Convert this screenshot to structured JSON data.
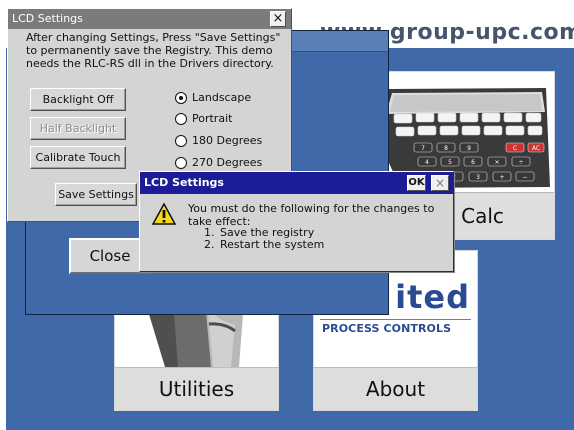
{
  "background": {
    "url_text": "www.group-upc.com",
    "colors": {
      "desktop_blue": "#3f69a9",
      "window_gray": "#d4d4d4",
      "active_title_blue": "#1c1d96",
      "inactive_title_gray": "#7b7b7b",
      "brand_blue": "#294b92"
    }
  },
  "app_cards": {
    "calc": {
      "label": "UPC Calc",
      "icon": "calculator-icon"
    },
    "utilities": {
      "label": "Utilities",
      "icon": "utilities-icon"
    },
    "about": {
      "label": "About",
      "brand_text": "ited",
      "brand_subtext": "PROCESS CONTROLS"
    }
  },
  "background_dialog": {
    "close_label": "Close"
  },
  "lcd_settings": {
    "title": "LCD Settings",
    "close_glyph": "×",
    "instructions": "After changing Settings, Press \"Save Settings\" to permanently save the Registry. This demo needs the RLC-RS dll in the Drivers directory.",
    "buttons": {
      "backlight_off": "Backlight Off",
      "half_backlight": "Half Backlight",
      "calibrate_touch": "Calibrate Touch",
      "save_settings": "Save Settings"
    },
    "orientation_options": [
      {
        "label": "Landscape",
        "selected": true
      },
      {
        "label": "Portrait",
        "selected": false
      },
      {
        "label": "180 Degrees",
        "selected": false
      },
      {
        "label": "270 Degrees",
        "selected": false
      }
    ]
  },
  "message_box": {
    "title": "LCD Settings",
    "ok_label": "OK",
    "close_glyph": "×",
    "icon": "warning-icon",
    "message": "You must do the following for the changes to take effect:",
    "steps": [
      "Save the registry",
      "Restart the system"
    ]
  }
}
